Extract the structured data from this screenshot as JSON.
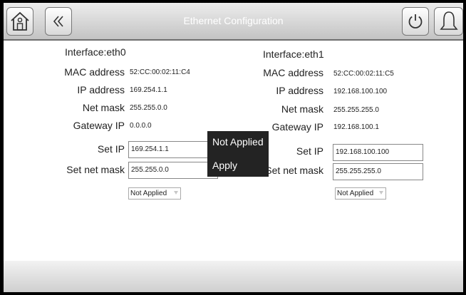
{
  "header": {
    "title": "Ethernet Configuration",
    "home_icon": "home-icon",
    "back_icon": "back-icon",
    "power_icon": "power-icon",
    "bell_icon": "bell-icon"
  },
  "eth0": {
    "interface": "Interface:eth0",
    "mac_label": "MAC address",
    "mac_value": "52:CC:00:02:11:C4",
    "ip_label": "IP address",
    "ip_value": "169.254.1.1",
    "mask_label": "Net mask",
    "mask_value": "255.255.0.0",
    "gw_label": "Gateway IP",
    "gw_value": "0.0.0.0",
    "set_ip_label": "Set IP",
    "set_ip_value": "169.254.1.1",
    "set_mask_label": "Set net mask",
    "set_mask_value": "255.255.0.0",
    "status_select": "Not Applied"
  },
  "eth1": {
    "interface": "Interface:eth1",
    "mac_label": "MAC address",
    "mac_value": "52:CC:00:02:11:C5",
    "ip_label": "IP address",
    "ip_value": "192.168.100.100",
    "mask_label": "Net mask",
    "mask_value": "255.255.255.0",
    "gw_label": "Gateway IP",
    "gw_value": "192.168.100.1",
    "set_ip_label": "Set IP",
    "set_ip_value": "192.168.100.100",
    "set_mask_label": "Set net mask",
    "set_mask_value": "255.255.255.0",
    "status_select": "Not Applied"
  },
  "popup_menu": {
    "items": [
      "Not Applied",
      "Apply"
    ]
  }
}
